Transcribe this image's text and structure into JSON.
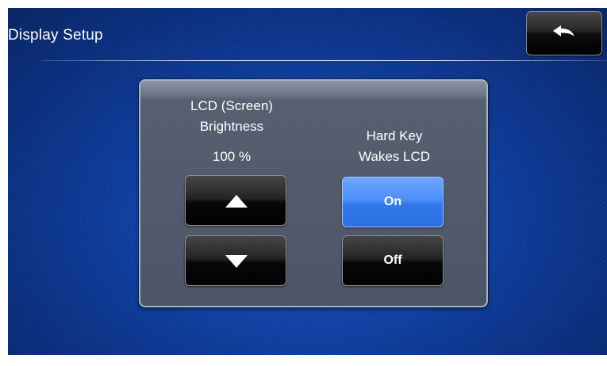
{
  "header": {
    "title": "Display Setup",
    "back_icon": "back-arrow-icon"
  },
  "lcd_brightness": {
    "label_line1": "LCD (Screen)",
    "label_line2": "Brightness",
    "value": "100 %",
    "up_icon": "triangle-up-icon",
    "down_icon": "triangle-down-icon"
  },
  "hard_key": {
    "label_line1": "Hard Key",
    "label_line2": "Wakes LCD",
    "on_label": "On",
    "off_label": "Off",
    "selected": "On"
  },
  "colors": {
    "background": "#0e3d9c",
    "selected_button": "#4d8ef7",
    "button": "#000000",
    "panel": "#566071"
  }
}
